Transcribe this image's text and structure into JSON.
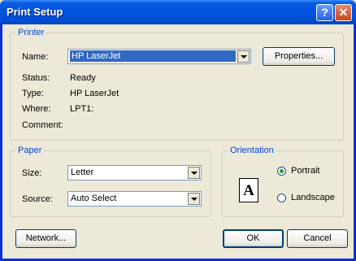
{
  "window": {
    "title": "Print Setup",
    "help_glyph": "?",
    "close_glyph": "✕"
  },
  "printer": {
    "legend": "Printer",
    "name_label": "Name:",
    "name_value": "HP LaserJet",
    "properties_button": "Properties...",
    "status_label": "Status:",
    "status_value": "Ready",
    "type_label": "Type:",
    "type_value": "HP LaserJet",
    "where_label": "Where:",
    "where_value": "LPT1:",
    "comment_label": "Comment:",
    "comment_value": ""
  },
  "paper": {
    "legend": "Paper",
    "size_label": "Size:",
    "size_value": "Letter",
    "source_label": "Source:",
    "source_value": "Auto Select"
  },
  "orientation": {
    "legend": "Orientation",
    "icon_letter": "A",
    "portrait_label": "Portrait",
    "landscape_label": "Landscape",
    "selected": "Portrait"
  },
  "buttons": {
    "network": "Network...",
    "ok": "OK",
    "cancel": "Cancel"
  },
  "colors": {
    "title_bar": "#0054e3",
    "selection": "#316ac5",
    "group_legend": "#0046d5"
  }
}
